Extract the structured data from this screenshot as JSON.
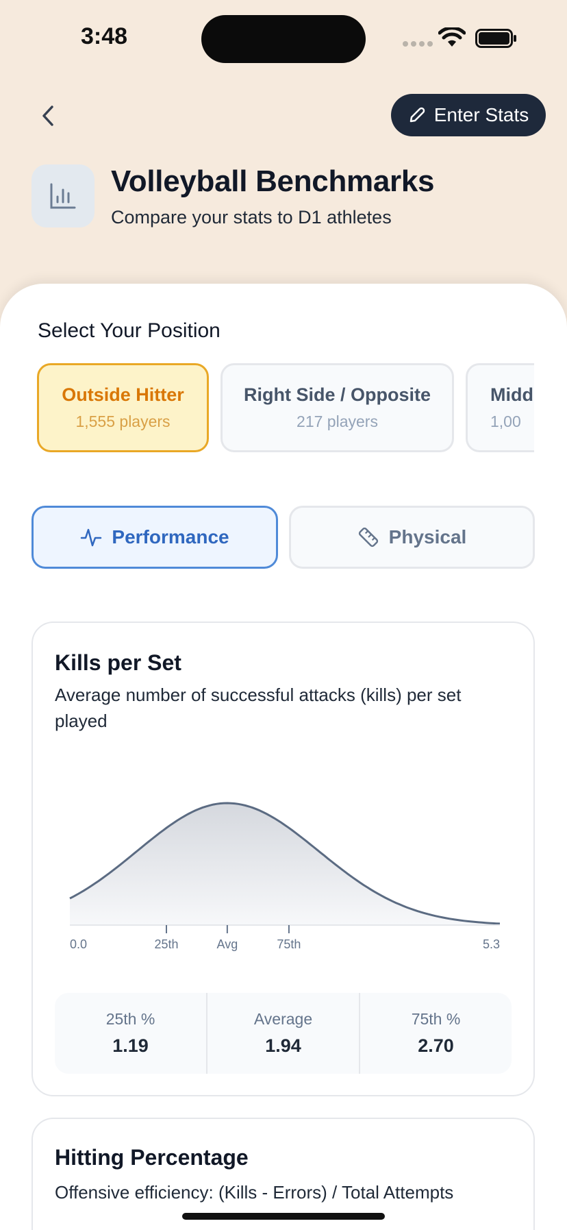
{
  "status_bar": {
    "time": "3:48"
  },
  "header": {
    "enter_stats_label": "Enter Stats",
    "title": "Volleyball Benchmarks",
    "subtitle": "Compare your stats to D1 athletes"
  },
  "position_section": {
    "label": "Select Your Position",
    "positions": [
      {
        "name": "Outside Hitter",
        "count": "1,555 players",
        "selected": true
      },
      {
        "name": "Right Side / Opposite",
        "count": "217 players",
        "selected": false
      },
      {
        "name": "Middle Blocker",
        "count": "1,00",
        "selected": false,
        "visible_name": "Middl",
        "visible_count": "1,00"
      }
    ]
  },
  "categories": [
    {
      "label": "Performance",
      "icon": "activity-icon",
      "selected": true
    },
    {
      "label": "Physical",
      "icon": "ruler-icon",
      "selected": false
    }
  ],
  "colors": {
    "accent_selected_position": "#e9a826",
    "accent_selected_category": "#4f8ad8",
    "dark_button": "#1e293b",
    "header_bg": "#f6eadd"
  },
  "metrics": [
    {
      "title": "Kills per Set",
      "description": "Average number of successful attacks (kills) per set played",
      "axis_min_label": "0.0",
      "axis_max_label": "5.3",
      "marker_labels": [
        "25th",
        "Avg",
        "75th"
      ],
      "stats": [
        {
          "label": "25th %",
          "value": "1.19"
        },
        {
          "label": "Average",
          "value": "1.94"
        },
        {
          "label": "75th %",
          "value": "2.70"
        }
      ]
    },
    {
      "title": "Hitting Percentage",
      "description": "Offensive efficiency: (Kills - Errors) / Total Attempts"
    }
  ],
  "chart_data": {
    "type": "area",
    "xlim": [
      0.0,
      5.3
    ],
    "distribution": {
      "p25": 1.19,
      "mean": 1.94,
      "p75": 2.7
    },
    "tick_labels": [
      "0.0",
      "25th",
      "Avg",
      "75th",
      "5.3"
    ],
    "grid": false
  }
}
